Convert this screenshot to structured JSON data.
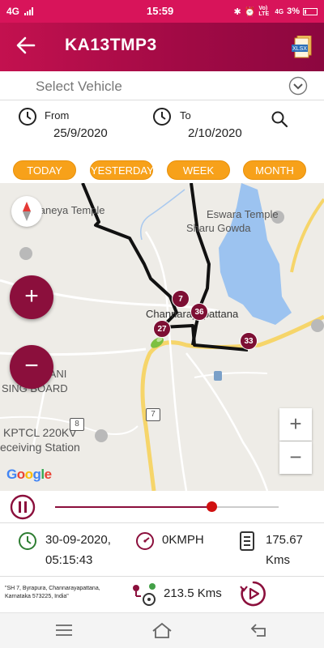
{
  "status_bar": {
    "network": "4G",
    "time": "15:59",
    "volte": "Vo) LTE",
    "signal2": "4G",
    "battery": "3%"
  },
  "header": {
    "title": "KA13TMP3",
    "export_icon_text": "XLSX"
  },
  "vehicle_select": {
    "placeholder": "Select Vehicle"
  },
  "date_range": {
    "from_label": "From",
    "from_value": "25/9/2020",
    "to_label": "To",
    "to_value": "2/10/2020"
  },
  "range_buttons": [
    "TODAY",
    "YESTERDAY",
    "WEEK",
    "MONTH"
  ],
  "map": {
    "labels": {
      "temple1": "Anjaneya Temple",
      "temple2": "Eswara Temple",
      "temple2b": "Sharu Gowda",
      "town": "Channarayapattana",
      "board1": "BANI",
      "board2": "SING BOARD",
      "kptcl1": "KPTCL 220KV",
      "kptcl2": "eceiving Station",
      "shield8": "8",
      "shield7": "7"
    },
    "pins": [
      "7",
      "36",
      "27",
      "33"
    ],
    "google": "Google",
    "zoom_in": "+",
    "zoom_out": "−"
  },
  "playback": {
    "progress": 0.7
  },
  "trip_info": {
    "datetime_line1": "30-09-2020,",
    "datetime_line2": "05:15:43",
    "speed": "0KMPH",
    "odometer_line1": "175.67",
    "odometer_line2": "Kms"
  },
  "address": {
    "text": "\"SH 7, Byrapura, Channarayapattana, Karnataka 573225, India\"",
    "distance": "213.5 Kms"
  },
  "colors": {
    "brand": "#a20a45",
    "accent": "#f7a11a",
    "route": "#111111"
  }
}
